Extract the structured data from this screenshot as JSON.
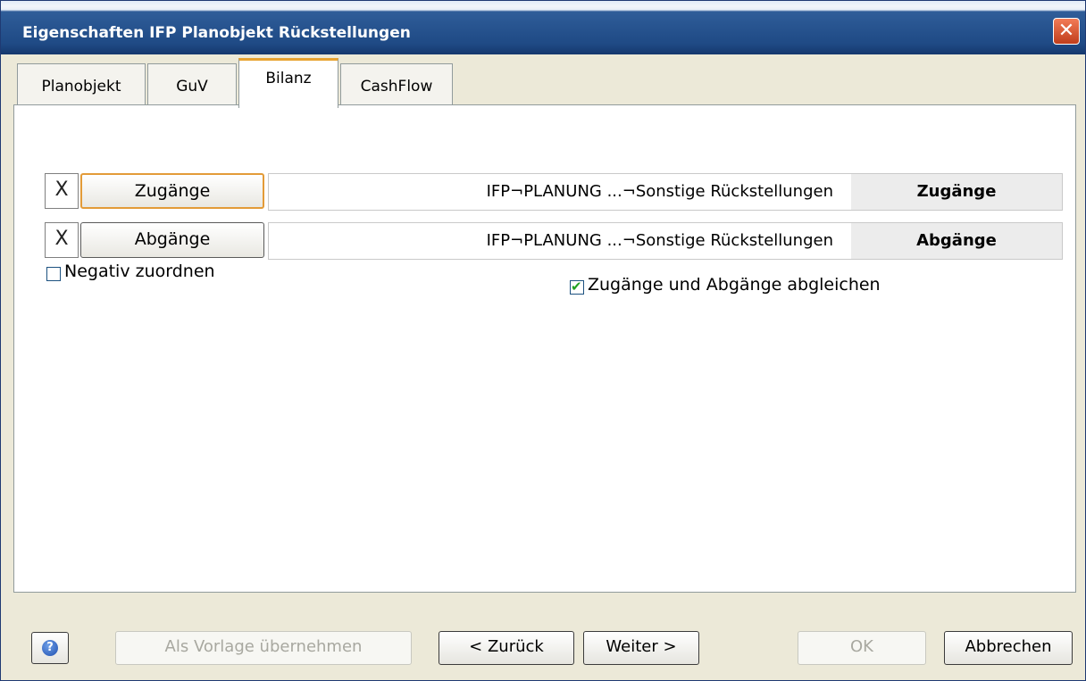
{
  "window": {
    "title": "Eigenschaften IFP Planobjekt Rückstellungen",
    "close_glyph": "✕"
  },
  "tabs": [
    {
      "label": "Planobjekt"
    },
    {
      "label": "GuV"
    },
    {
      "label": "Bilanz"
    },
    {
      "label": "CashFlow"
    }
  ],
  "rows": [
    {
      "x_label": "X",
      "button_label": "Zugänge",
      "path": "IFP¬PLANUNG ...¬Sonstige Rückstellungen",
      "target": "Zugänge"
    },
    {
      "x_label": "X",
      "button_label": "Abgänge",
      "path": "IFP¬PLANUNG ...¬Sonstige Rückstellungen",
      "target": "Abgänge"
    }
  ],
  "options": {
    "negativ_zuordnen": {
      "label": "Negativ zuordnen",
      "checked": false
    },
    "abgleichen": {
      "label": "Zugänge und Abgänge abgleichen",
      "checked": true
    }
  },
  "footer": {
    "help_glyph": "?",
    "als_vorlage": "Als Vorlage übernehmen",
    "zurueck": "< Zurück",
    "weiter": "Weiter >",
    "ok": "OK",
    "abbrechen": "Abbrechen"
  }
}
